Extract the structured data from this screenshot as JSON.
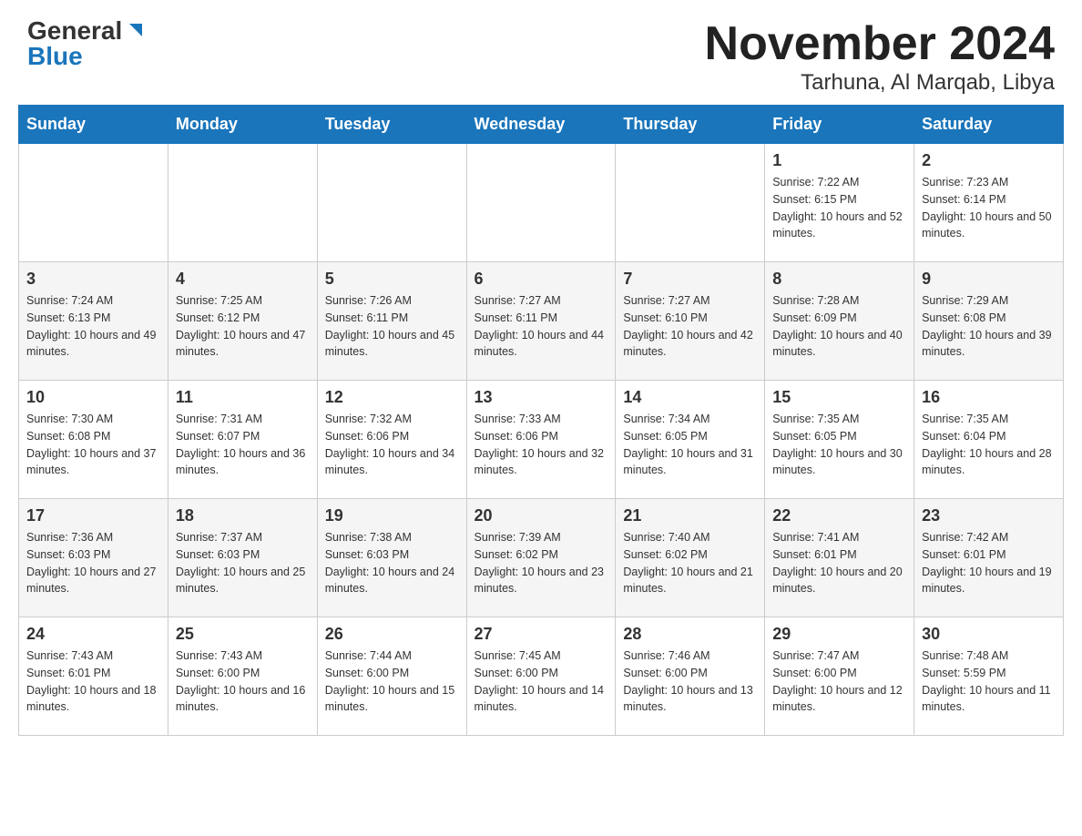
{
  "header": {
    "logo_general": "General",
    "logo_blue": "Blue",
    "title": "November 2024",
    "subtitle": "Tarhuna, Al Marqab, Libya"
  },
  "calendar": {
    "days_of_week": [
      "Sunday",
      "Monday",
      "Tuesday",
      "Wednesday",
      "Thursday",
      "Friday",
      "Saturday"
    ],
    "weeks": [
      [
        {
          "day": "",
          "info": ""
        },
        {
          "day": "",
          "info": ""
        },
        {
          "day": "",
          "info": ""
        },
        {
          "day": "",
          "info": ""
        },
        {
          "day": "",
          "info": ""
        },
        {
          "day": "1",
          "info": "Sunrise: 7:22 AM\nSunset: 6:15 PM\nDaylight: 10 hours and 52 minutes."
        },
        {
          "day": "2",
          "info": "Sunrise: 7:23 AM\nSunset: 6:14 PM\nDaylight: 10 hours and 50 minutes."
        }
      ],
      [
        {
          "day": "3",
          "info": "Sunrise: 7:24 AM\nSunset: 6:13 PM\nDaylight: 10 hours and 49 minutes."
        },
        {
          "day": "4",
          "info": "Sunrise: 7:25 AM\nSunset: 6:12 PM\nDaylight: 10 hours and 47 minutes."
        },
        {
          "day": "5",
          "info": "Sunrise: 7:26 AM\nSunset: 6:11 PM\nDaylight: 10 hours and 45 minutes."
        },
        {
          "day": "6",
          "info": "Sunrise: 7:27 AM\nSunset: 6:11 PM\nDaylight: 10 hours and 44 minutes."
        },
        {
          "day": "7",
          "info": "Sunrise: 7:27 AM\nSunset: 6:10 PM\nDaylight: 10 hours and 42 minutes."
        },
        {
          "day": "8",
          "info": "Sunrise: 7:28 AM\nSunset: 6:09 PM\nDaylight: 10 hours and 40 minutes."
        },
        {
          "day": "9",
          "info": "Sunrise: 7:29 AM\nSunset: 6:08 PM\nDaylight: 10 hours and 39 minutes."
        }
      ],
      [
        {
          "day": "10",
          "info": "Sunrise: 7:30 AM\nSunset: 6:08 PM\nDaylight: 10 hours and 37 minutes."
        },
        {
          "day": "11",
          "info": "Sunrise: 7:31 AM\nSunset: 6:07 PM\nDaylight: 10 hours and 36 minutes."
        },
        {
          "day": "12",
          "info": "Sunrise: 7:32 AM\nSunset: 6:06 PM\nDaylight: 10 hours and 34 minutes."
        },
        {
          "day": "13",
          "info": "Sunrise: 7:33 AM\nSunset: 6:06 PM\nDaylight: 10 hours and 32 minutes."
        },
        {
          "day": "14",
          "info": "Sunrise: 7:34 AM\nSunset: 6:05 PM\nDaylight: 10 hours and 31 minutes."
        },
        {
          "day": "15",
          "info": "Sunrise: 7:35 AM\nSunset: 6:05 PM\nDaylight: 10 hours and 30 minutes."
        },
        {
          "day": "16",
          "info": "Sunrise: 7:35 AM\nSunset: 6:04 PM\nDaylight: 10 hours and 28 minutes."
        }
      ],
      [
        {
          "day": "17",
          "info": "Sunrise: 7:36 AM\nSunset: 6:03 PM\nDaylight: 10 hours and 27 minutes."
        },
        {
          "day": "18",
          "info": "Sunrise: 7:37 AM\nSunset: 6:03 PM\nDaylight: 10 hours and 25 minutes."
        },
        {
          "day": "19",
          "info": "Sunrise: 7:38 AM\nSunset: 6:03 PM\nDaylight: 10 hours and 24 minutes."
        },
        {
          "day": "20",
          "info": "Sunrise: 7:39 AM\nSunset: 6:02 PM\nDaylight: 10 hours and 23 minutes."
        },
        {
          "day": "21",
          "info": "Sunrise: 7:40 AM\nSunset: 6:02 PM\nDaylight: 10 hours and 21 minutes."
        },
        {
          "day": "22",
          "info": "Sunrise: 7:41 AM\nSunset: 6:01 PM\nDaylight: 10 hours and 20 minutes."
        },
        {
          "day": "23",
          "info": "Sunrise: 7:42 AM\nSunset: 6:01 PM\nDaylight: 10 hours and 19 minutes."
        }
      ],
      [
        {
          "day": "24",
          "info": "Sunrise: 7:43 AM\nSunset: 6:01 PM\nDaylight: 10 hours and 18 minutes."
        },
        {
          "day": "25",
          "info": "Sunrise: 7:43 AM\nSunset: 6:00 PM\nDaylight: 10 hours and 16 minutes."
        },
        {
          "day": "26",
          "info": "Sunrise: 7:44 AM\nSunset: 6:00 PM\nDaylight: 10 hours and 15 minutes."
        },
        {
          "day": "27",
          "info": "Sunrise: 7:45 AM\nSunset: 6:00 PM\nDaylight: 10 hours and 14 minutes."
        },
        {
          "day": "28",
          "info": "Sunrise: 7:46 AM\nSunset: 6:00 PM\nDaylight: 10 hours and 13 minutes."
        },
        {
          "day": "29",
          "info": "Sunrise: 7:47 AM\nSunset: 6:00 PM\nDaylight: 10 hours and 12 minutes."
        },
        {
          "day": "30",
          "info": "Sunrise: 7:48 AM\nSunset: 5:59 PM\nDaylight: 10 hours and 11 minutes."
        }
      ]
    ]
  }
}
